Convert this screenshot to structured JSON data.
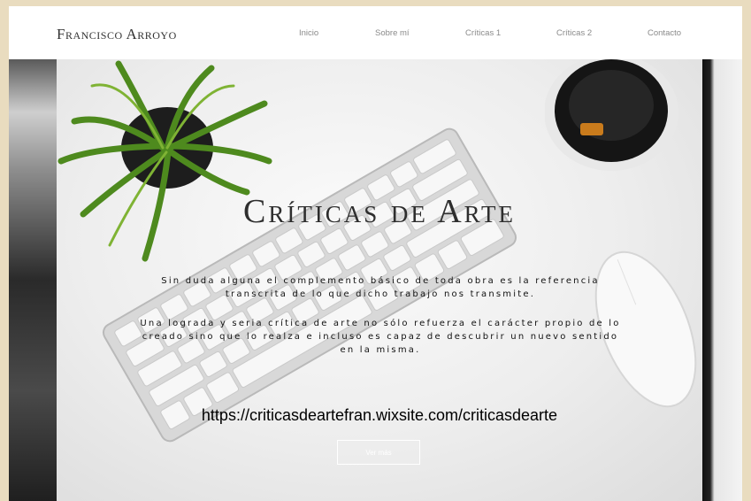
{
  "site": {
    "title": "Francisco Arroyo"
  },
  "nav": {
    "items": [
      {
        "label": "Inicio"
      },
      {
        "label": "Sobre mí"
      },
      {
        "label": "Críticas 1"
      },
      {
        "label": "Críticas 2"
      },
      {
        "label": "Contacto"
      }
    ]
  },
  "hero": {
    "title": "Críticas de Arte",
    "paragraph1": "Sin duda alguna el complemento básico de toda obra es la referencia transcrita de lo que dicho trabajo nos transmite.",
    "paragraph2": "Una lograda y seria crítica de arte no sólo refuerza el carácter propio de lo creado sino que lo realza e incluso es capaz de descubrir un nuevo sentido en la misma.",
    "url": "https://criticasdeartefran.wixsite.com/criticasdearte",
    "button_label": "Ver más"
  },
  "colors": {
    "outer_background": "#e9dcbf",
    "header_background": "#ffffff",
    "nav_text": "#8a8a8a",
    "title_text": "#2e2e2e"
  }
}
